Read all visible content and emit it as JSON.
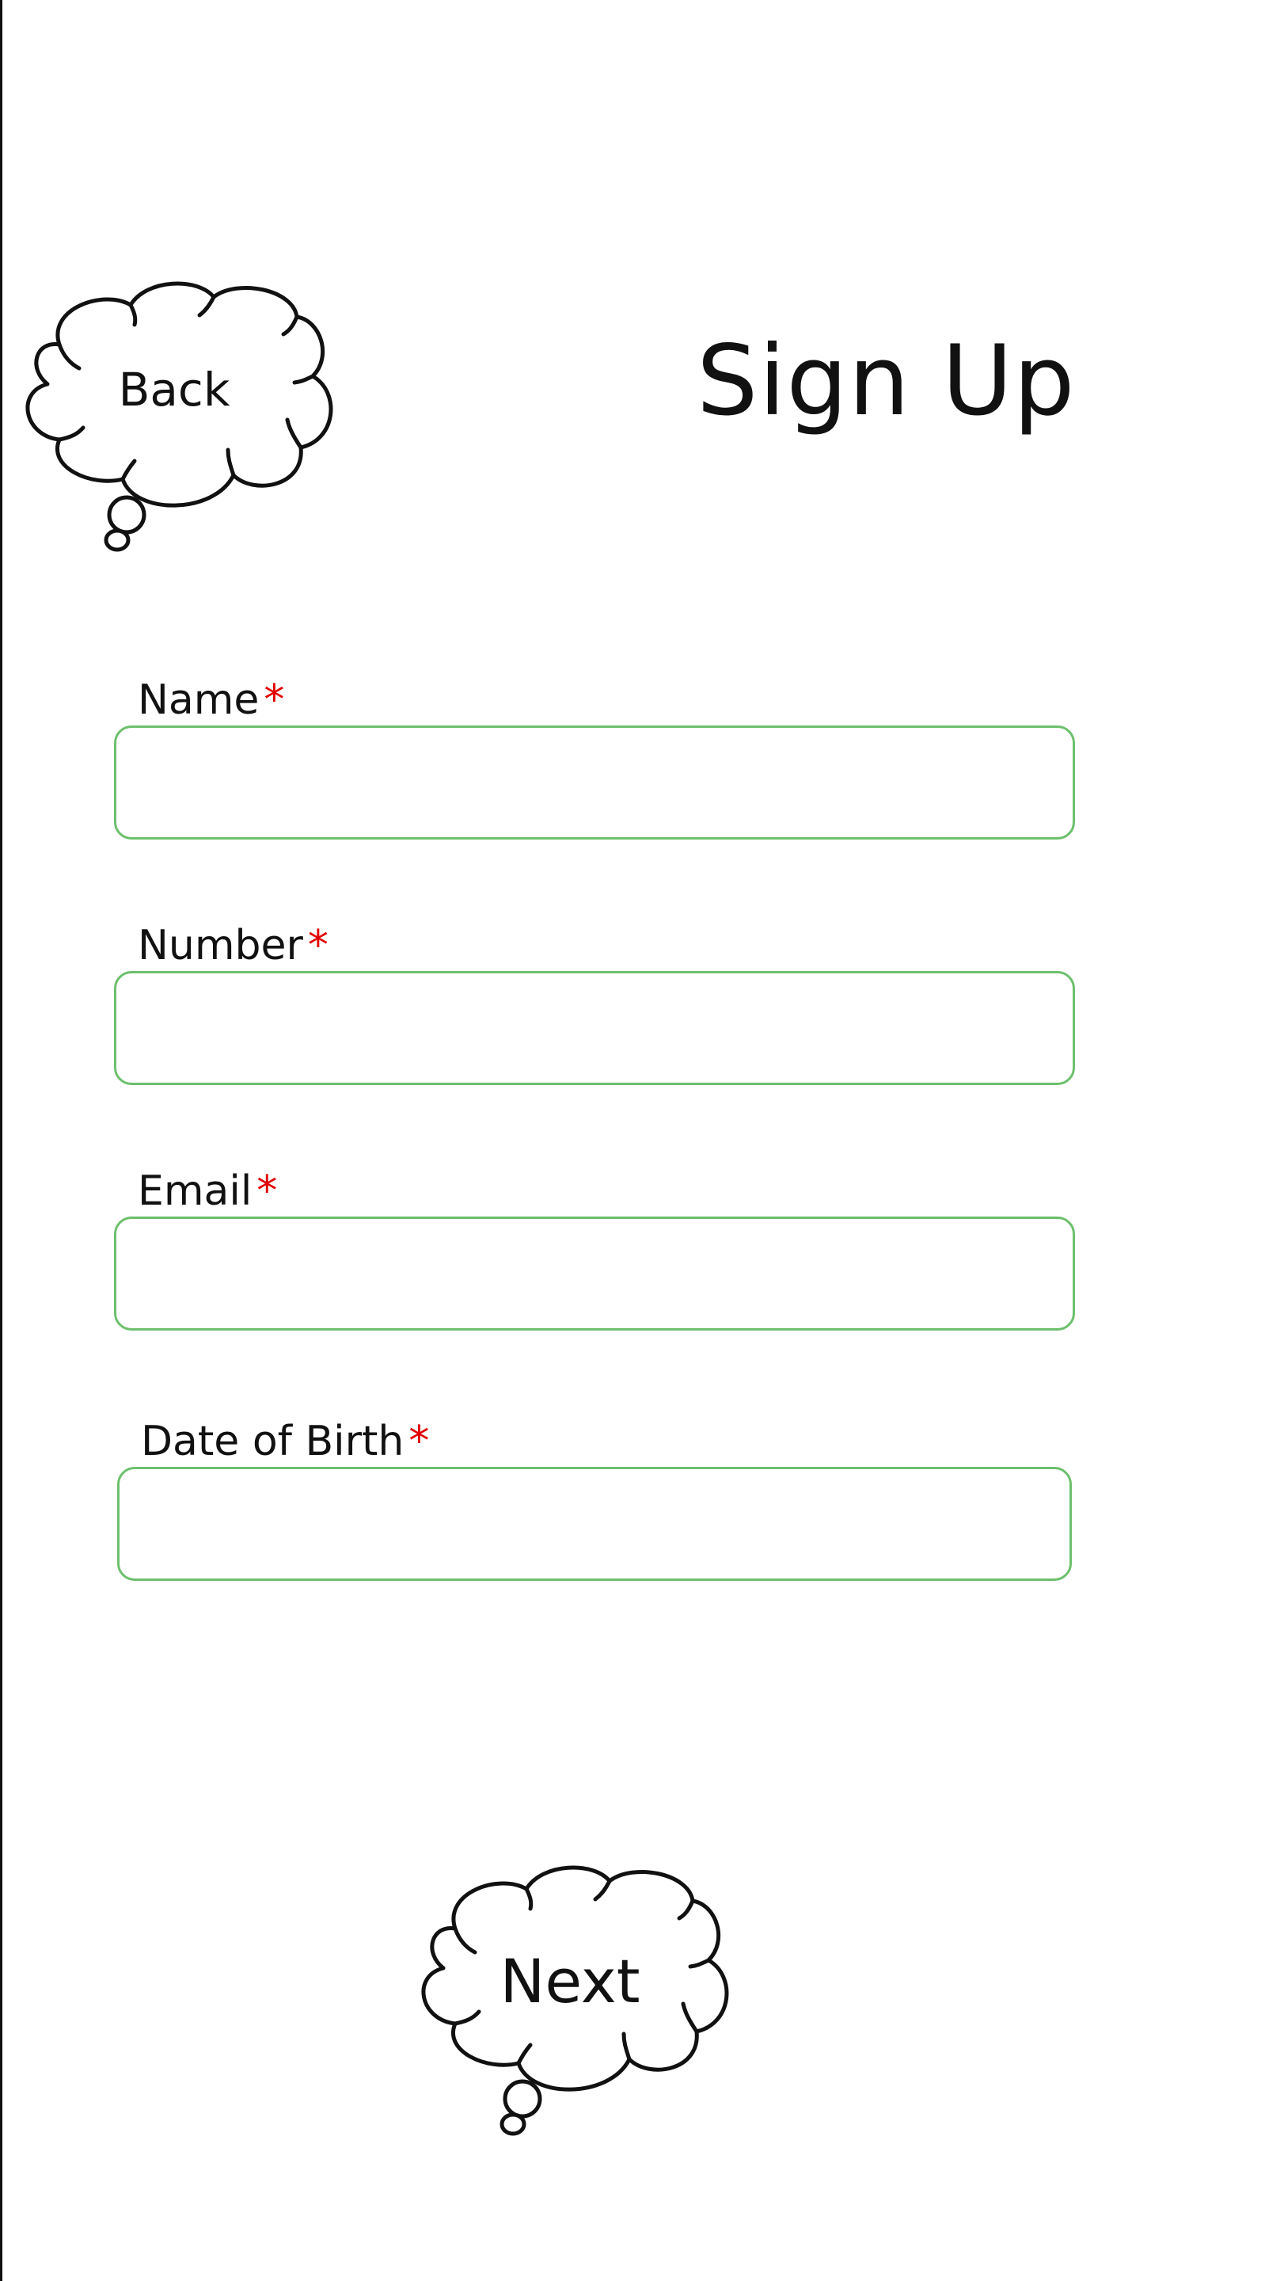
{
  "header": {
    "title": "Sign Up",
    "back_label": "Back"
  },
  "form": {
    "required_marker": "*",
    "fields": [
      {
        "label": "Name",
        "value": "",
        "placeholder": ""
      },
      {
        "label": "Number",
        "value": "",
        "placeholder": ""
      },
      {
        "label": "Email",
        "value": "",
        "placeholder": ""
      },
      {
        "label": "Date of Birth",
        "value": "",
        "placeholder": ""
      }
    ]
  },
  "footer": {
    "next_label": "Next"
  },
  "colors": {
    "input_border": "#6cc06c",
    "required": "#e00000",
    "text": "#111111",
    "background": "#ffffff"
  },
  "icons": {
    "back": "thought-bubble-icon",
    "next": "thought-bubble-icon"
  }
}
